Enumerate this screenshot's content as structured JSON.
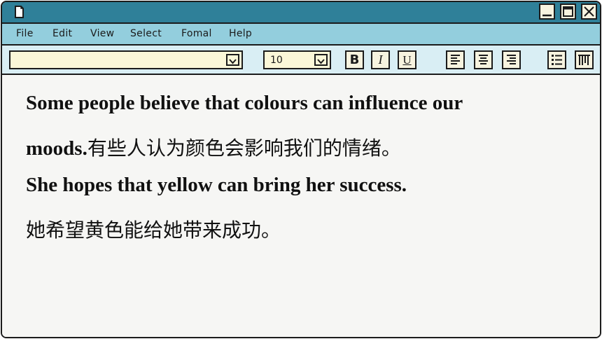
{
  "window": {
    "icons": {
      "app": "document-icon",
      "minimize": "minimize-icon",
      "maximize": "maximize-icon",
      "close": "close-icon"
    }
  },
  "menu": {
    "items": [
      "File",
      "Edit",
      "View",
      "Select",
      "Fomal",
      "Help"
    ]
  },
  "toolbar": {
    "font_name_value": "",
    "font_size_value": "10",
    "bold_label": "B",
    "italic_label": "I",
    "underline_label": "U",
    "icons": [
      "chevron-down-icon",
      "align-left-icon",
      "align-center-icon",
      "align-right-icon",
      "bullet-list-icon",
      "columns-icon"
    ]
  },
  "document": {
    "line1": "Some people believe that colours can influence our",
    "line2_en": "moods.",
    "line2_zh": "有些人认为颜色会影响我们的情绪。",
    "line3": "She hopes that yellow can bring her success.",
    "line4": "她希望黄色能给她带来成功。"
  },
  "colors": {
    "titlebar": "#2f8099",
    "menubar": "#93cedd",
    "toolbar": "#d9eef4",
    "input_bg": "#fbf7d8",
    "content_bg": "#f6f6f4"
  }
}
